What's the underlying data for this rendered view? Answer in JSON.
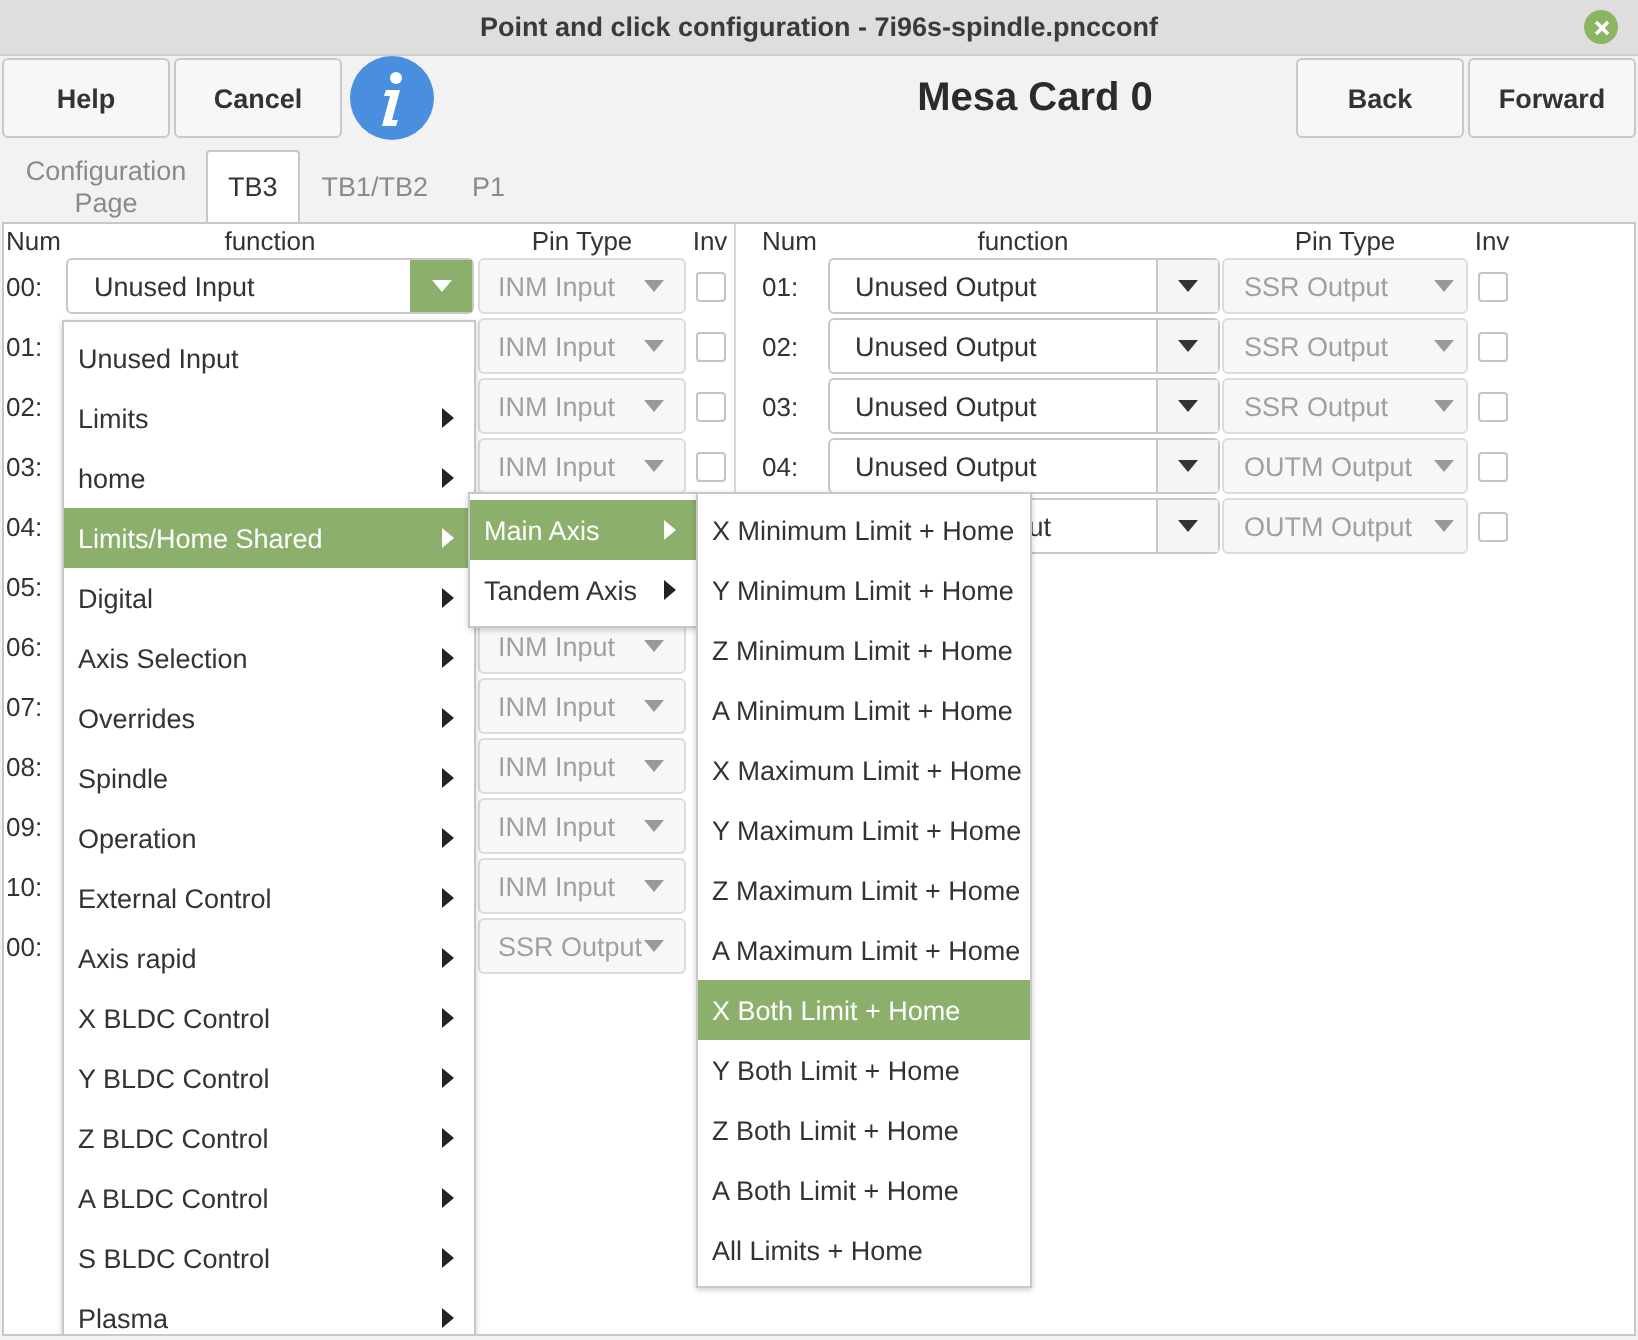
{
  "window": {
    "title": "Point and click configuration - 7i96s-spindle.pncconf"
  },
  "toolbar": {
    "left_buttons": [
      "Help",
      "Cancel"
    ],
    "heading": "Mesa Card 0",
    "right_buttons": [
      "Back",
      "Forward"
    ]
  },
  "tabs": [
    {
      "label": "Configuration Page",
      "selected": false
    },
    {
      "label": "TB3",
      "selected": true
    },
    {
      "label": "TB1/TB2",
      "selected": false
    },
    {
      "label": "P1",
      "selected": false
    }
  ],
  "left_table": {
    "columns": [
      "Num",
      "function",
      "Pin Type",
      "Inv"
    ],
    "rows": [
      {
        "num": "00:",
        "function": "Unused Input",
        "open": true,
        "pin_type": "INM Input",
        "inv": false
      },
      {
        "num": "01:",
        "pin_type": "INM Input",
        "inv": false
      },
      {
        "num": "02:",
        "pin_type": "INM Input",
        "inv": false
      },
      {
        "num": "03:",
        "pin_type": "INM Input",
        "inv": false
      },
      {
        "num": "04:"
      },
      {
        "num": "05:"
      },
      {
        "num": "06:",
        "pin_type": "INM Input"
      },
      {
        "num": "07:",
        "pin_type": "INM Input"
      },
      {
        "num": "08:",
        "pin_type": "INM Input"
      },
      {
        "num": "09:",
        "pin_type": "INM Input"
      },
      {
        "num": "10:",
        "pin_type": "INM Input"
      },
      {
        "num": "00:",
        "pin_type": "SSR Output"
      }
    ]
  },
  "right_table": {
    "columns": [
      "Num",
      "function",
      "Pin Type",
      "Inv"
    ],
    "rows": [
      {
        "num": "01:",
        "function": "Unused Output",
        "open": false,
        "pin_type": "SSR Output",
        "inv": false
      },
      {
        "num": "02:",
        "function": "Unused Output",
        "open": false,
        "pin_type": "SSR Output",
        "inv": false
      },
      {
        "num": "03:",
        "function": "Unused Output",
        "open": false,
        "pin_type": "SSR Output",
        "inv": false
      },
      {
        "num": "04:",
        "function": "Unused Output",
        "open": false,
        "pin_type": "OUTM Output",
        "inv": false
      },
      {
        "function": "ut",
        "kind": "clipped",
        "open": false,
        "pin_type": "OUTM Output",
        "inv": false
      }
    ]
  },
  "menus": [
    {
      "items": [
        {
          "label": "Unused Input",
          "submenu": false,
          "selected": false
        },
        {
          "label": "Limits",
          "submenu": true,
          "selected": false
        },
        {
          "label": "home",
          "submenu": true,
          "selected": false
        },
        {
          "label": "Limits/Home Shared",
          "submenu": true,
          "selected": true
        },
        {
          "label": "Digital",
          "submenu": true,
          "selected": false
        },
        {
          "label": "Axis Selection",
          "submenu": true,
          "selected": false
        },
        {
          "label": "Overrides",
          "submenu": true,
          "selected": false
        },
        {
          "label": "Spindle",
          "submenu": true,
          "selected": false
        },
        {
          "label": "Operation",
          "submenu": true,
          "selected": false
        },
        {
          "label": "External Control",
          "submenu": true,
          "selected": false
        },
        {
          "label": "Axis rapid",
          "submenu": true,
          "selected": false
        },
        {
          "label": "X BLDC Control",
          "submenu": true,
          "selected": false
        },
        {
          "label": "Y BLDC Control",
          "submenu": true,
          "selected": false
        },
        {
          "label": "Z BLDC Control",
          "submenu": true,
          "selected": false
        },
        {
          "label": "A BLDC Control",
          "submenu": true,
          "selected": false
        },
        {
          "label": "S BLDC Control",
          "submenu": true,
          "selected": false
        },
        {
          "label": "Plasma",
          "submenu": true,
          "selected": false
        }
      ]
    },
    {
      "items": [
        {
          "label": "Main Axis",
          "submenu": true,
          "selected": true
        },
        {
          "label": "Tandem Axis",
          "submenu": true,
          "selected": false
        }
      ]
    },
    {
      "items": [
        {
          "label": "X Minimum Limit + Home",
          "submenu": false,
          "selected": false
        },
        {
          "label": "Y Minimum Limit + Home",
          "submenu": false,
          "selected": false
        },
        {
          "label": "Z Minimum Limit + Home",
          "submenu": false,
          "selected": false
        },
        {
          "label": "A Minimum Limit + Home",
          "submenu": false,
          "selected": false
        },
        {
          "label": "X Maximum Limit + Home",
          "submenu": false,
          "selected": false
        },
        {
          "label": "Y Maximum Limit + Home",
          "submenu": false,
          "selected": false
        },
        {
          "label": "Z Maximum Limit + Home",
          "submenu": false,
          "selected": false
        },
        {
          "label": "A Maximum Limit + Home",
          "submenu": false,
          "selected": false
        },
        {
          "label": "X Both Limit + Home",
          "submenu": false,
          "selected": true
        },
        {
          "label": "Y Both Limit + Home",
          "submenu": false,
          "selected": false
        },
        {
          "label": "Z Both Limit + Home",
          "submenu": false,
          "selected": false
        },
        {
          "label": "A Both Limit + Home",
          "submenu": false,
          "selected": false
        },
        {
          "label": "All Limits + Home",
          "submenu": false,
          "selected": false
        }
      ]
    }
  ]
}
